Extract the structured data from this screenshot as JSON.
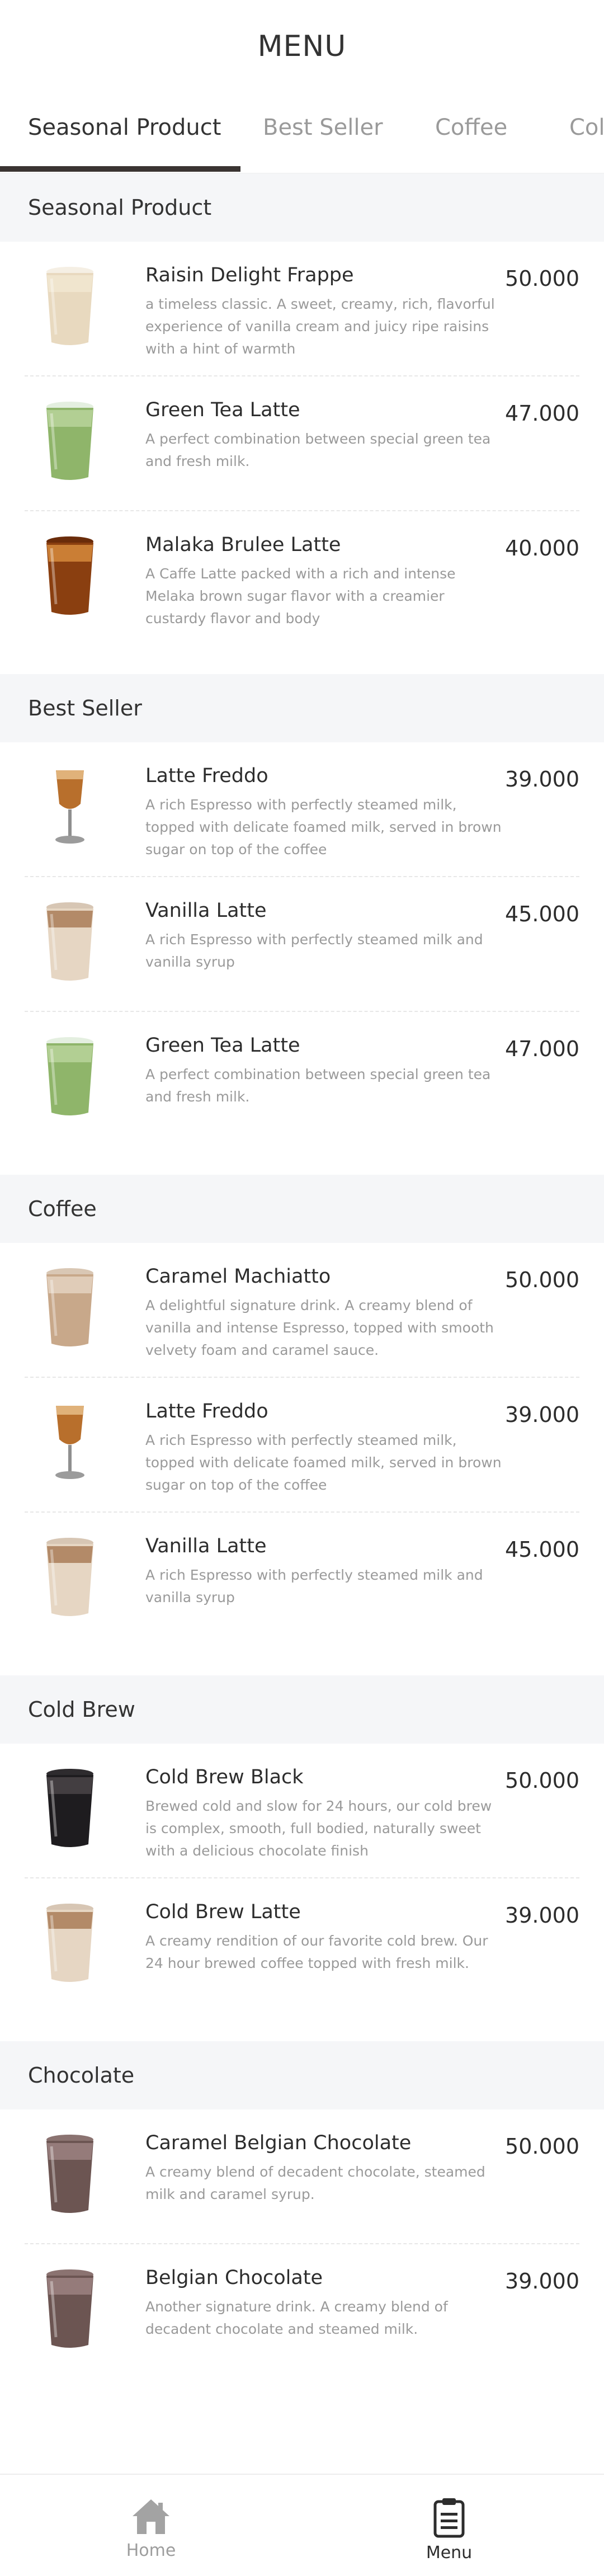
{
  "header": {
    "title": "MENU"
  },
  "tabs": [
    {
      "label": "Seasonal Product"
    },
    {
      "label": "Best Seller"
    },
    {
      "label": "Coffee"
    },
    {
      "label": "Cold Brew"
    }
  ],
  "colors": {
    "accent": "#3a3432",
    "section_bg": "#f5f6f8",
    "muted_text": "#9a9a9a"
  },
  "sections": [
    {
      "title": "Seasonal Product",
      "items": [
        {
          "name": "Raisin Delight Frappe",
          "price": "50.000",
          "desc": "a timeless classic. A sweet, creamy, rich, flavorful experience of vanilla cream and juicy ripe raisins with a hint of warmth",
          "icon": "frappe-cup-icon"
        },
        {
          "name": "Green Tea Latte",
          "price": "47.000",
          "desc": "A perfect combination between  special green tea and fresh milk.",
          "icon": "green-tea-cup-icon"
        },
        {
          "name": "Malaka Brulee Latte",
          "price": "40.000",
          "desc": "A Caffe Latte packed with a rich and intense Melaka brown sugar flavor with a creamier custardy flavor and body",
          "icon": "brown-sugar-latte-icon"
        }
      ]
    },
    {
      "title": "Best Seller",
      "items": [
        {
          "name": "Latte Freddo",
          "price": "39.000",
          "desc": "A rich Espresso with perfectly steamed milk, topped with delicate foamed milk, served in brown sugar on top of the coffee",
          "icon": "goblet-icon"
        },
        {
          "name": "Vanilla Latte",
          "price": "45.000",
          "desc": "A rich Espresso with perfectly steamed milk and vanilla syrup",
          "icon": "iced-latte-icon"
        },
        {
          "name": "Green Tea Latte",
          "price": "47.000",
          "desc": "A perfect combination between  special green tea and fresh milk.",
          "icon": "green-tea-cup-icon"
        }
      ]
    },
    {
      "title": "Coffee",
      "items": [
        {
          "name": "Caramel Machiatto",
          "price": "50.000",
          "desc": "A delightful signature drink. A creamy blend of vanilla and intense Espresso, topped with smooth velvety foam and caramel sauce.",
          "icon": "caramel-cup-icon"
        },
        {
          "name": "Latte Freddo",
          "price": "39.000",
          "desc": "A rich Espresso with perfectly steamed milk, topped with delicate foamed milk, served in brown sugar on top of the coffee",
          "icon": "goblet-icon"
        },
        {
          "name": "Vanilla Latte",
          "price": "45.000",
          "desc": "A rich Espresso with perfectly steamed milk and vanilla syrup",
          "icon": "iced-latte-icon"
        }
      ]
    },
    {
      "title": "Cold Brew",
      "items": [
        {
          "name": "Cold Brew Black",
          "price": "50.000",
          "desc": "Brewed cold and slow for 24 hours, our cold brew is complex, smooth, full bodied, naturally sweet with a delicious chocolate finish",
          "icon": "black-coffee-cup-icon"
        },
        {
          "name": "Cold Brew Latte",
          "price": "39.000",
          "desc": "A creamy rendition of our favorite cold brew. Our 24 hour brewed coffee topped with fresh milk.",
          "icon": "iced-latte-icon"
        }
      ]
    },
    {
      "title": "Chocolate",
      "items": [
        {
          "name": "Caramel Belgian Chocolate",
          "price": "50.000",
          "desc": "A creamy blend of decadent chocolate, steamed milk and caramel syrup.",
          "icon": "chocolate-cup-icon"
        },
        {
          "name": "Belgian Chocolate",
          "price": "39.000",
          "desc": "Another signature drink. A creamy blend of decadent chocolate and steamed milk.",
          "icon": "chocolate-cup-icon"
        }
      ]
    }
  ],
  "bottom_nav": {
    "home_label": "Home",
    "menu_label": "Menu"
  }
}
